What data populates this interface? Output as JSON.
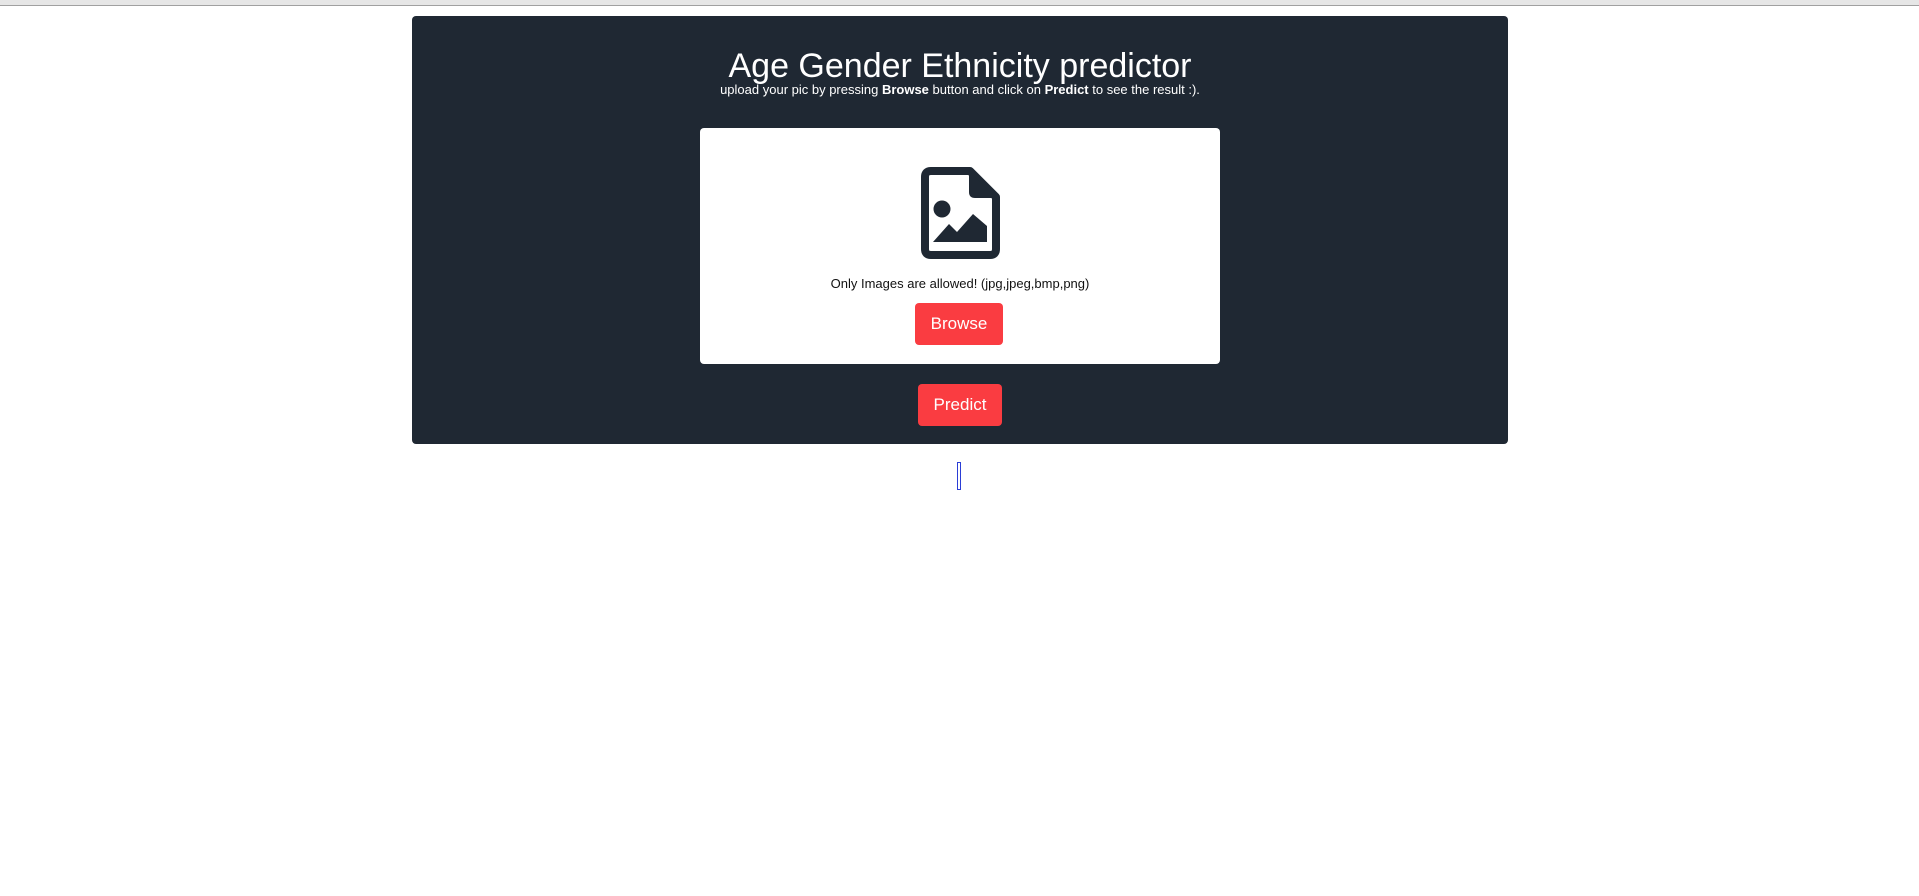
{
  "header": {
    "title": "Age Gender Ethnicity predictor",
    "subtitle_parts": {
      "p1": "upload your pic by pressing ",
      "b1": "Browse",
      "p2": " button and click on ",
      "b2": "Predict",
      "p3": " to see the result :)."
    }
  },
  "upload": {
    "icon": "file-image-icon",
    "allowed_text": "Only Images are allowed! (jpg,jpeg,bmp,png)",
    "browse_label": "Browse"
  },
  "actions": {
    "predict_label": "Predict"
  },
  "colors": {
    "panel_bg": "#1f2833",
    "accent": "#fa3c41",
    "icon": "#1f2833"
  }
}
